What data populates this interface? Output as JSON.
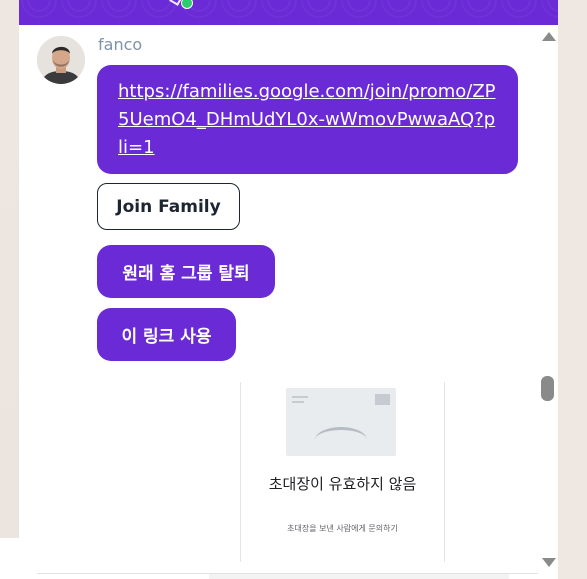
{
  "colors": {
    "accent": "#6a2bd6",
    "online": "#2ecc71",
    "sender_name": "#7e93a8",
    "dark_text": "#1d2533"
  },
  "header": {
    "status": "online"
  },
  "message": {
    "sender": "fanco",
    "link": "https://families.google.com/join/promo/ZP5UemO4_DHmUdYL0x-wWmovPwwaAQ?pli=1",
    "buttons": {
      "join_family": "Join Family",
      "leave_home_group": "원래 홈 그룹 탈퇴",
      "use_this_link": "이 링크 사용"
    }
  },
  "preview": {
    "title": "초대장이 유효하지 않음",
    "subtitle": "초대장을 보낸 사람에게 문의하기",
    "image_icon": "broken-envelope-icon"
  },
  "scrollbar": {
    "up_icon": "scroll-up-arrow-icon",
    "down_icon": "scroll-down-arrow-icon"
  }
}
